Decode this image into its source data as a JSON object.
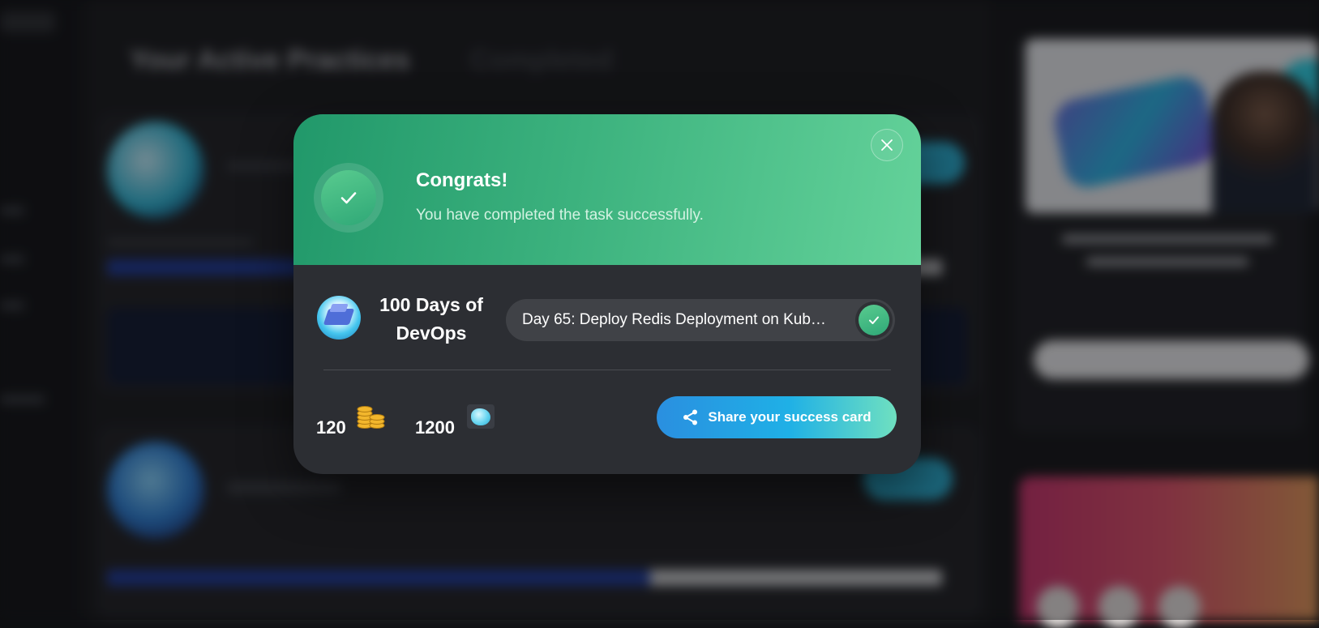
{
  "background": {
    "page_title": "Your Active Practices",
    "tab_completed": "Completed"
  },
  "modal": {
    "title": "Congrats!",
    "subtitle": "You have completed the task successfully.",
    "close_icon": "close-icon",
    "course": {
      "title": "100 Days of DevOps",
      "task": "Day 65: Deploy Redis Deployment on Kub…",
      "task_status_icon": "check-icon"
    },
    "rewards": {
      "coins": "120",
      "coins_icon": "coin-stack-icon",
      "gems": "1200",
      "gems_icon": "gem-icon"
    },
    "share_button": {
      "label": "Share your success card",
      "icon": "share-icon"
    },
    "colors": {
      "header_start": "#21986a",
      "header_end": "#64d29a",
      "modal_bg": "#2c2e33",
      "share_start": "#2a8fe0",
      "share_end": "#6fe0c0"
    }
  }
}
